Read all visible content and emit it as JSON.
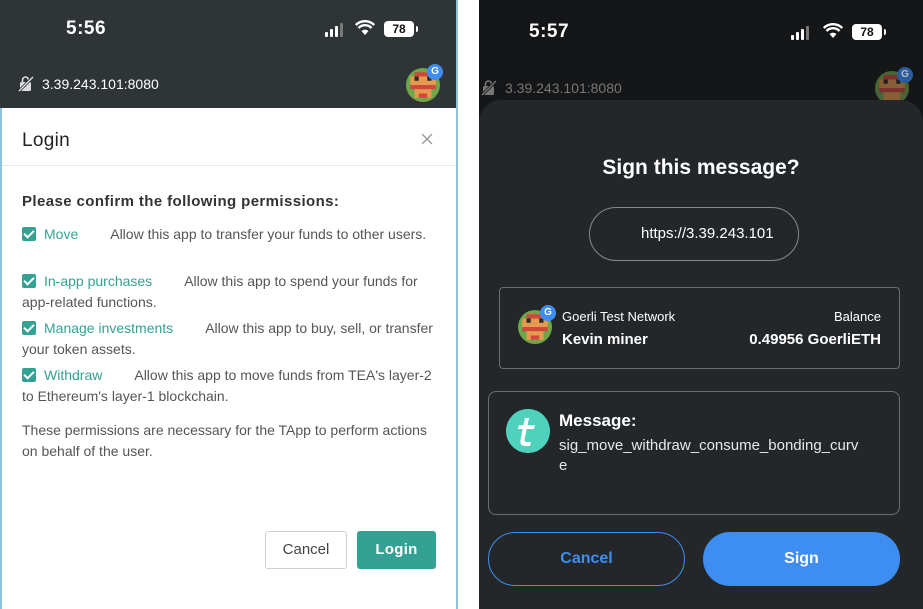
{
  "left_phone": {
    "status": {
      "time": "5:56",
      "battery": "78"
    },
    "url": "3.39.243.101:8080",
    "avatar_badge": "G",
    "modal": {
      "title": "Login",
      "permissions_heading": "Please confirm the following permissions:",
      "permissions": [
        {
          "name": "Move",
          "gap": "      ",
          "desc": "Allow this app to transfer your funds to other users."
        },
        {
          "name": "In-app purchases",
          "gap": "      ",
          "desc": "Allow this app to spend your funds for app-related functions."
        },
        {
          "name": "Manage investments",
          "gap": "      ",
          "desc": "Allow this app to buy, sell, or transfer your token assets."
        },
        {
          "name": "Withdraw",
          "gap": "      ",
          "desc": "Allow this app to move funds from TEA's layer-2 to Ethereum's layer-1 blockchain."
        }
      ],
      "note": "These permissions are necessary for the TApp to perform actions on behalf of the user.",
      "cancel_label": "Cancel",
      "login_label": "Login"
    }
  },
  "right_phone": {
    "status": {
      "time": "5:57",
      "battery": "78"
    },
    "url": "3.39.243.101:8080",
    "avatar_badge": "G",
    "sheet": {
      "title": "Sign this message?",
      "origin": "https://3.39.243.101",
      "network": "Goerli Test Network",
      "account_name": "Kevin miner",
      "balance_label": "Balance",
      "balance_value": "0.49956 GoerliETH",
      "message_label": "Message:",
      "message_body": "sig_move_withdraw_consume_bonding_curve",
      "cancel_label": "Cancel",
      "sign_label": "Sign"
    }
  },
  "colors": {
    "teal_accent": "#34a195",
    "blue_accent": "#3d8ef0",
    "dark_header": "#2f3437",
    "sheet_bg": "#24272a"
  }
}
